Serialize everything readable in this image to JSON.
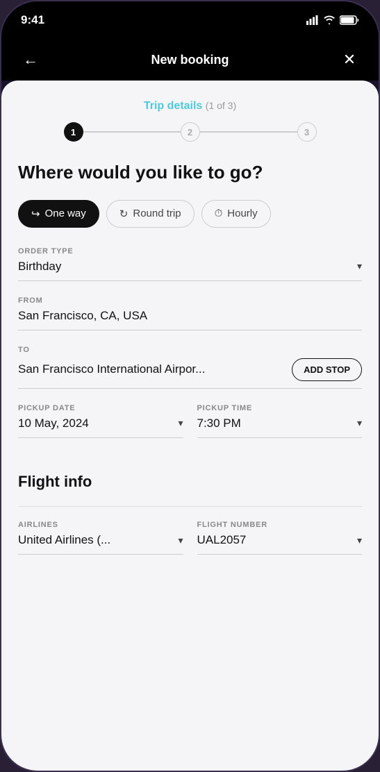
{
  "statusBar": {
    "time": "9:41"
  },
  "navBar": {
    "title": "New booking",
    "back": "←",
    "close": "✕"
  },
  "progress": {
    "title": "Trip details",
    "subtitle": "(1 of 3)",
    "steps": [
      {
        "number": "1",
        "active": true
      },
      {
        "number": "2",
        "active": false
      },
      {
        "number": "3",
        "active": false
      }
    ]
  },
  "mainHeading": "Where would you like to go?",
  "tripTypes": [
    {
      "label": "One way",
      "active": true,
      "icon": "↪"
    },
    {
      "label": "Round trip",
      "active": false,
      "icon": "↻"
    },
    {
      "label": "Hourly",
      "active": false,
      "icon": "🕐"
    }
  ],
  "fields": {
    "orderType": {
      "label": "ORDER TYPE",
      "value": "Birthday"
    },
    "from": {
      "label": "FROM",
      "value": "San Francisco, CA, USA"
    },
    "to": {
      "label": "TO",
      "value": "San Francisco International Airpor...",
      "addStopLabel": "ADD STOP"
    },
    "pickupDate": {
      "label": "PICKUP DATE",
      "value": "10 May, 2024"
    },
    "pickupTime": {
      "label": "PICKUP TIME",
      "value": "7:30 PM"
    }
  },
  "flightInfo": {
    "heading": "Flight info",
    "airlines": {
      "label": "AIRLINES",
      "value": "United Airlines (..."
    },
    "flightNumber": {
      "label": "FLIGHT NUMBER",
      "value": "UAL2057"
    }
  }
}
